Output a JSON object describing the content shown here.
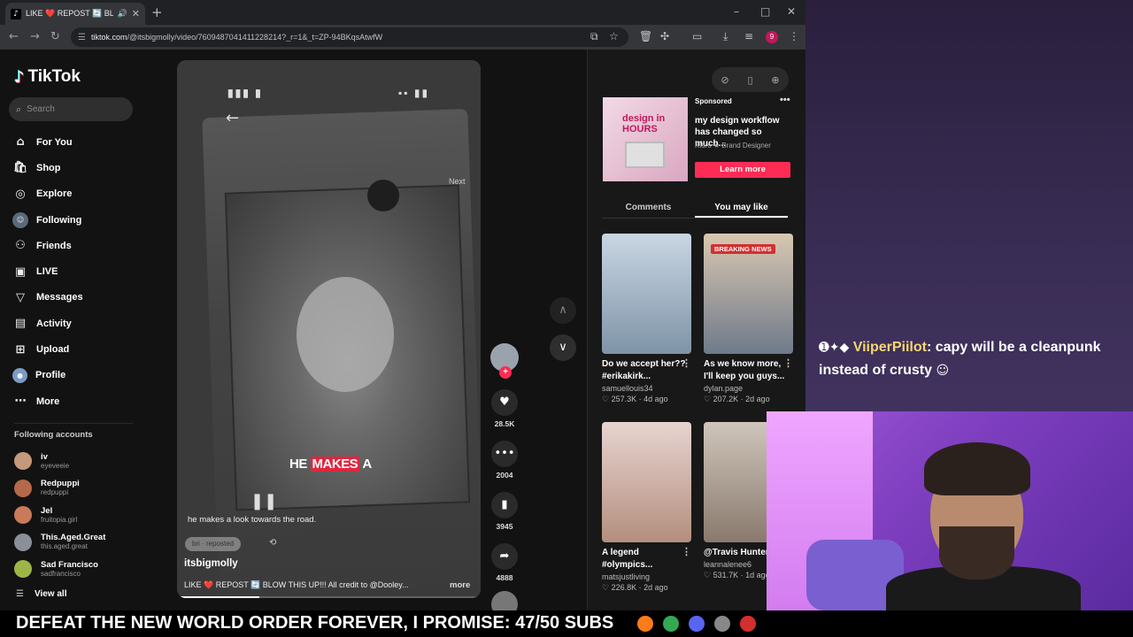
{
  "browser": {
    "tab_title": "LIKE ❤️ REPOST 🔄 BLOW",
    "tab_favicon": "tiktok-logo",
    "new_tab": "+",
    "url_host": "tiktok.com",
    "url_path": "/@itsbigmolly/video/7609487041411228214?_r=1&_t=ZP-94BKqsAtwfW",
    "profile_badge": "9"
  },
  "sidebar": {
    "logo": "TikTok",
    "search_placeholder": "Search",
    "nav": [
      {
        "label": "For You",
        "icon": "home-icon"
      },
      {
        "label": "Shop",
        "icon": "shop-icon"
      },
      {
        "label": "Explore",
        "icon": "compass-icon"
      },
      {
        "label": "Following",
        "icon": "following-avatar"
      },
      {
        "label": "Friends",
        "icon": "friends-icon"
      },
      {
        "label": "LIVE",
        "icon": "live-icon"
      },
      {
        "label": "Messages",
        "icon": "messages-icon"
      },
      {
        "label": "Activity",
        "icon": "activity-icon"
      },
      {
        "label": "Upload",
        "icon": "upload-icon"
      },
      {
        "label": "Profile",
        "icon": "profile-avatar"
      },
      {
        "label": "More",
        "icon": "more-icon"
      }
    ],
    "following_title": "Following accounts",
    "accounts": [
      {
        "name": "iv",
        "handle": "eyeveeie",
        "color": "#c49a7a"
      },
      {
        "name": "Redpuppi",
        "handle": "redpuppi",
        "color": "#b5694a"
      },
      {
        "name": "Jel",
        "handle": "fruitopia.girl",
        "color": "#c97a5a"
      },
      {
        "name": "This.Aged.Great",
        "handle": "this.aged.great",
        "color": "#8a8f99"
      },
      {
        "name": "Sad Francisco",
        "handle": "sadfrancisco",
        "color": "#9cb547"
      }
    ],
    "view_all": "View all"
  },
  "video": {
    "caption_word1": "HE",
    "caption_word2": "MAKES",
    "caption_word3": "A",
    "phone_next": "Next",
    "subtitle": "he makes a look towards the road.",
    "repost_pill": "bri · reposted",
    "author": "itsbigmolly",
    "description": "LIKE ❤️ REPOST 🔄 BLOW THIS UP!!! All credit to @Dooley...",
    "more": "more",
    "progress": 0.27
  },
  "actions": {
    "likes": "28.5K",
    "comments": "2004",
    "saves": "3945",
    "shares": "4888"
  },
  "ad": {
    "sponsored": "Sponsored",
    "thumb_text": "design in HOURS",
    "headline": "my design workflow has changed so much...",
    "brand": "Klaro ★ Brand Designer",
    "cta": "Learn more"
  },
  "tabs": {
    "comments": "Comments",
    "you_may_like": "You may like"
  },
  "cards": [
    {
      "caption": "Do we accept her?? #erikakirk...",
      "user": "samuellouis34",
      "likes": "257.3K",
      "age": "4d ago",
      "colors": [
        "#c9d6e3",
        "#7f94a8"
      ]
    },
    {
      "caption": "As we know more, I'll keep you guys...",
      "user": "dylan.page",
      "likes": "207.2K",
      "age": "2d ago",
      "colors": [
        "#d9c7b0",
        "#6e7a8a"
      ],
      "badge": "BREAKING NEWS"
    },
    {
      "caption": "A legend #olympics...",
      "user": "matsjustliving",
      "likes": "226.8K",
      "age": "2d ago",
      "colors": [
        "#e7d4d0",
        "#b48e7e"
      ]
    },
    {
      "caption": "@Travis Hunter",
      "user": "leannaleneе6",
      "likes": "531.7K",
      "age": "1d ago",
      "colors": [
        "#cfc5bb",
        "#8a7a6d"
      ]
    }
  ],
  "chat": {
    "user": "ViiperPiilot",
    "message": "capy will be a cleanpunk instead of crusty"
  },
  "banner": "DEFEAT THE NEW WORLD ORDER FOREVER, I PROMISE: 47/50 SUBS"
}
